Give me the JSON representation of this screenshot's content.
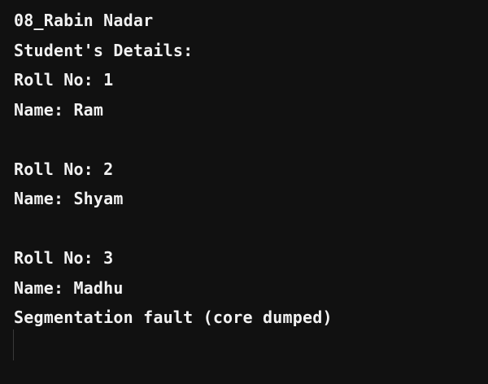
{
  "terminal": {
    "lines": [
      "08_Rabin Nadar",
      "Student's Details:",
      "Roll No: 1",
      "Name: Ram",
      "",
      "Roll No: 2",
      "Name: Shyam",
      "",
      "Roll No: 3",
      "Name: Madhu",
      "Segmentation fault (core dumped)"
    ],
    "colors": {
      "background": "#111111",
      "text": "#f2f2f2"
    }
  }
}
